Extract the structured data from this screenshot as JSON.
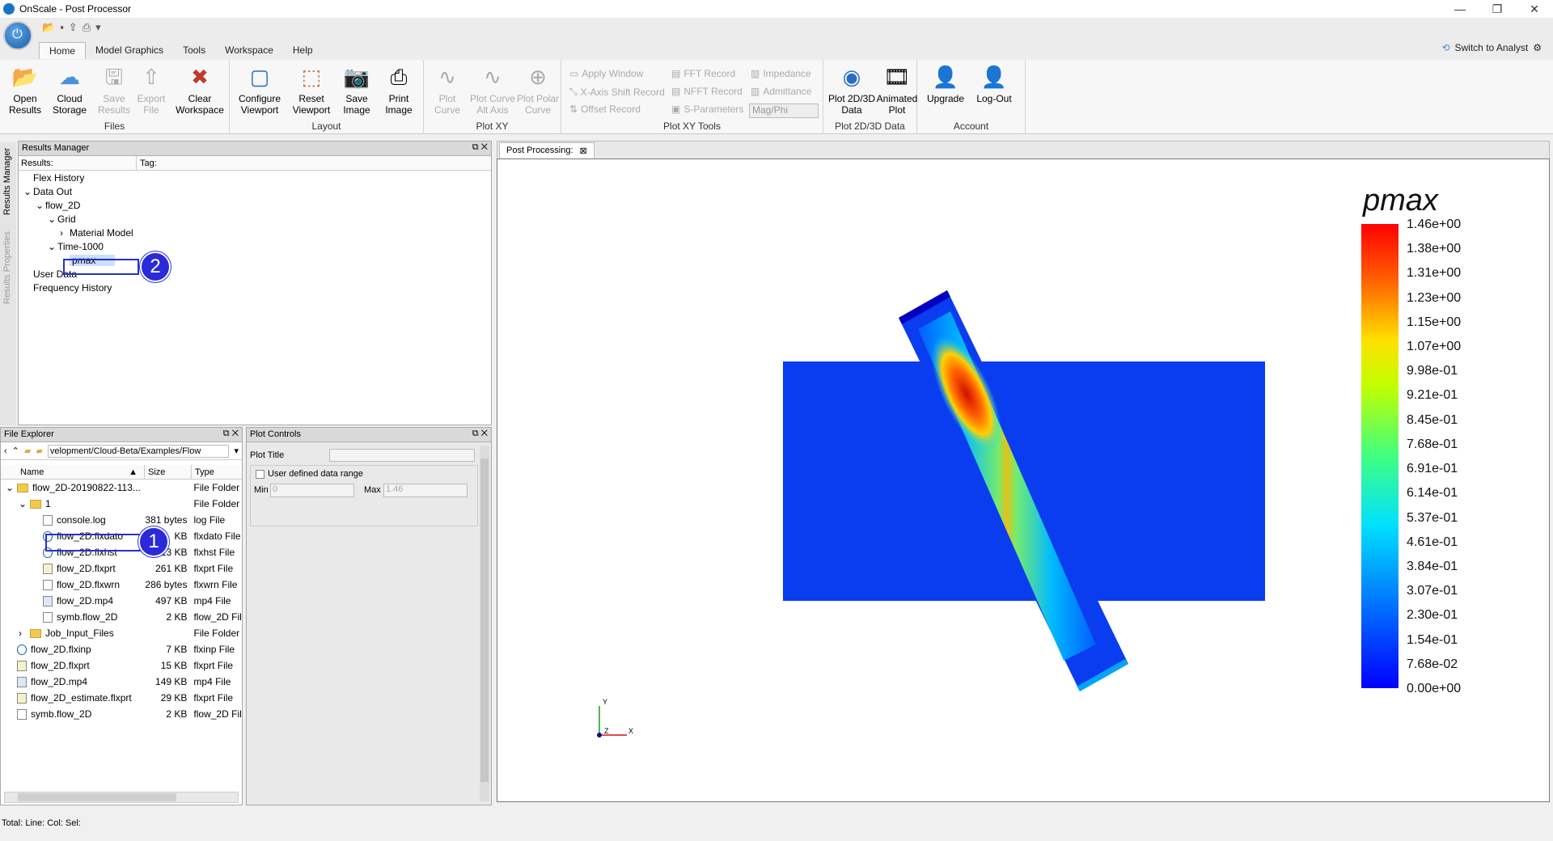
{
  "window": {
    "title": "OnScale - Post Processor",
    "controls": [
      "—",
      "❐",
      "✕"
    ]
  },
  "menu": {
    "tabs": [
      "Home",
      "Model Graphics",
      "Tools",
      "Workspace",
      "Help"
    ],
    "active": "Home",
    "switch_label": "Switch to Analyst"
  },
  "ribbon": {
    "files": {
      "name": "Files",
      "open": "Open\nResults",
      "cloud": "Cloud\nStorage",
      "save": "Save\nResults",
      "export": "Export\nFile",
      "clear": "Clear\nWorkspace"
    },
    "layout": {
      "name": "Layout",
      "configure": "Configure\nViewport",
      "reset": "Reset\nViewport",
      "save_image": "Save\nImage",
      "print_image": "Print\nImage"
    },
    "plotxy": {
      "name": "Plot XY",
      "plot_curve": "Plot\nCurve",
      "alt_axis": "Plot Curve\nAlt Axis",
      "polar": "Plot Polar\nCurve"
    },
    "plotxytools": {
      "name": "Plot XY Tools",
      "apply_window": "Apply Window",
      "xaxis_shift": "X-Axis Shift Record",
      "offset": "Offset Record",
      "fft": "FFT Record",
      "nfft": "NFFT Record",
      "sparams": "S-Parameters",
      "impedance": "Impedance",
      "admittance": "Admittance",
      "magphi": "Mag/Phi"
    },
    "plot2d3d": {
      "name": "Plot 2D/3D Data",
      "plot": "Plot 2D/3D\nData",
      "animated": "Animated\nPlot"
    },
    "account": {
      "name": "Account",
      "upgrade": "Upgrade",
      "logout": "Log-Out"
    }
  },
  "side_tabs": [
    "Results Manager",
    "Results Properties"
  ],
  "results_manager": {
    "title": "Results Manager",
    "col_results": "Results:",
    "col_tag": "Tag:",
    "tree": [
      {
        "label": "Flex History",
        "indent": 0,
        "arrow": ""
      },
      {
        "label": "Data Out",
        "indent": 0,
        "arrow": "⌄"
      },
      {
        "label": "flow_2D",
        "indent": 1,
        "arrow": "⌄"
      },
      {
        "label": "Grid",
        "indent": 2,
        "arrow": "⌄"
      },
      {
        "label": "Material Model",
        "indent": 3,
        "arrow": "›"
      },
      {
        "label": "Time-1000",
        "indent": 2,
        "arrow": "⌄"
      },
      {
        "label": "pmax",
        "indent": 3,
        "arrow": ""
      },
      {
        "label": "User Data",
        "indent": 0,
        "arrow": ""
      },
      {
        "label": "Frequency History",
        "indent": 0,
        "arrow": ""
      }
    ]
  },
  "file_explorer": {
    "title": "File Explorer",
    "path": "velopment/Cloud-Beta/Examples/Flow",
    "col_name": "Name",
    "col_size": "Size",
    "col_type": "Type",
    "rows": [
      {
        "name": "flow_2D-20190822-113...",
        "size": "",
        "type": "File Folder",
        "indent": 0,
        "kind": "folder",
        "arrow": "⌄"
      },
      {
        "name": "1",
        "size": "",
        "type": "File Folder",
        "indent": 1,
        "kind": "folder",
        "arrow": "⌄"
      },
      {
        "name": "console.log",
        "size": "381 bytes",
        "type": "log File",
        "indent": 2,
        "kind": "file",
        "arrow": ""
      },
      {
        "name": "flow_2D.flxdato",
        "size": "KB",
        "type": "flxdato File",
        "indent": 2,
        "kind": "onscale",
        "arrow": ""
      },
      {
        "name": "flow_2D.flxhst",
        "size": "13 KB",
        "type": "flxhst File",
        "indent": 2,
        "kind": "onscale",
        "arrow": ""
      },
      {
        "name": "flow_2D.flxprt",
        "size": "261 KB",
        "type": "flxprt File",
        "indent": 2,
        "kind": "edit",
        "arrow": ""
      },
      {
        "name": "flow_2D.flxwrn",
        "size": "286 bytes",
        "type": "flxwrn File",
        "indent": 2,
        "kind": "file",
        "arrow": ""
      },
      {
        "name": "flow_2D.mp4",
        "size": "497 KB",
        "type": "mp4 File",
        "indent": 2,
        "kind": "media",
        "arrow": ""
      },
      {
        "name": "symb.flow_2D",
        "size": "2 KB",
        "type": "flow_2D File",
        "indent": 2,
        "kind": "file",
        "arrow": ""
      },
      {
        "name": "Job_Input_Files",
        "size": "",
        "type": "File Folder",
        "indent": 1,
        "kind": "folder",
        "arrow": "›"
      },
      {
        "name": "flow_2D.flxinp",
        "size": "7 KB",
        "type": "flxinp File",
        "indent": 0,
        "kind": "onscale",
        "arrow": ""
      },
      {
        "name": "flow_2D.flxprt",
        "size": "15 KB",
        "type": "flxprt File",
        "indent": 0,
        "kind": "edit",
        "arrow": ""
      },
      {
        "name": "flow_2D.mp4",
        "size": "149 KB",
        "type": "mp4 File",
        "indent": 0,
        "kind": "media",
        "arrow": ""
      },
      {
        "name": "flow_2D_estimate.flxprt",
        "size": "29 KB",
        "type": "flxprt File",
        "indent": 0,
        "kind": "edit",
        "arrow": ""
      },
      {
        "name": "symb.flow_2D",
        "size": "2 KB",
        "type": "flow_2D File",
        "indent": 0,
        "kind": "file",
        "arrow": ""
      }
    ]
  },
  "plot_controls": {
    "title": "Plot Controls",
    "plot_title_label": "Plot Title",
    "user_range_label": "User defined data range",
    "min_label": "Min",
    "min_value": "0",
    "max_label": "Max",
    "max_value": "1.46"
  },
  "viewport": {
    "tab": "Post Processing:",
    "legend_title": "pmax",
    "legend_labels": [
      "1.46e+00",
      "1.38e+00",
      "1.31e+00",
      "1.23e+00",
      "1.15e+00",
      "1.07e+00",
      "9.98e-01",
      "9.21e-01",
      "8.45e-01",
      "7.68e-01",
      "6.91e-01",
      "6.14e-01",
      "5.37e-01",
      "4.61e-01",
      "3.84e-01",
      "3.07e-01",
      "2.30e-01",
      "1.54e-01",
      "7.68e-02",
      "0.00e+00"
    ],
    "axis_y": "Y",
    "axis_x": "X",
    "axis_z": "Z"
  },
  "callouts": [
    "1",
    "2"
  ],
  "statusbar": {
    "text": "Total:  Line:  Col:  Sel:"
  }
}
